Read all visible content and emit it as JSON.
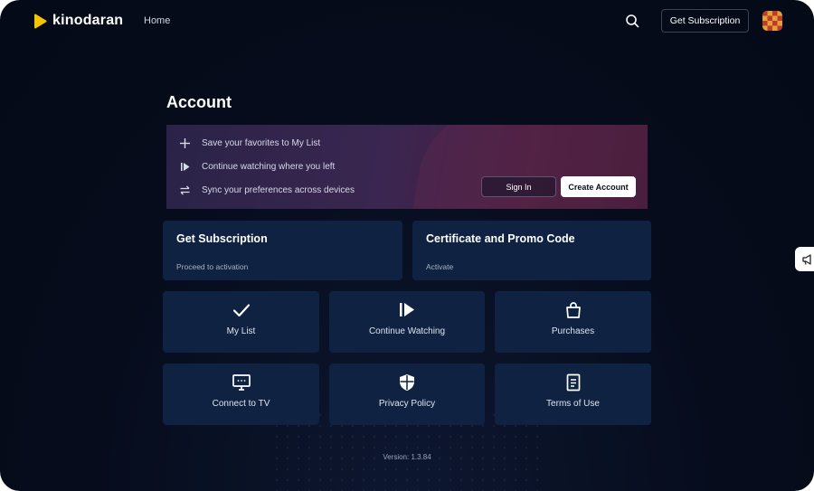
{
  "header": {
    "logo_text": "kinodaran",
    "nav_home": "Home",
    "get_subscription": "Get Subscription"
  },
  "page": {
    "title": "Account"
  },
  "banner": {
    "perks": [
      {
        "icon": "plus-icon",
        "text": "Save your favorites to My List"
      },
      {
        "icon": "play-icon",
        "text": "Continue watching where you left"
      },
      {
        "icon": "sync-icon",
        "text": "Sync your preferences across devices"
      }
    ],
    "sign_in": "Sign In",
    "create_account": "Create Account"
  },
  "cards": {
    "subscription": {
      "title": "Get Subscription",
      "subtitle": "Proceed to activation"
    },
    "promo": {
      "title": "Certificate and Promo Code",
      "subtitle": "Activate"
    }
  },
  "tiles": [
    {
      "icon": "check-icon",
      "label": "My List"
    },
    {
      "icon": "play-icon",
      "label": "Continue Watching"
    },
    {
      "icon": "bag-icon",
      "label": "Purchases"
    },
    {
      "icon": "tv-icon",
      "label": "Connect to TV"
    },
    {
      "icon": "shield-icon",
      "label": "Privacy Policy"
    },
    {
      "icon": "document-icon",
      "label": "Terms of Use"
    }
  ],
  "footer": {
    "version": "Version: 1.3.84"
  },
  "colors": {
    "background": "#060c1c",
    "card": "#0f2241",
    "brand": "#f5c400"
  }
}
